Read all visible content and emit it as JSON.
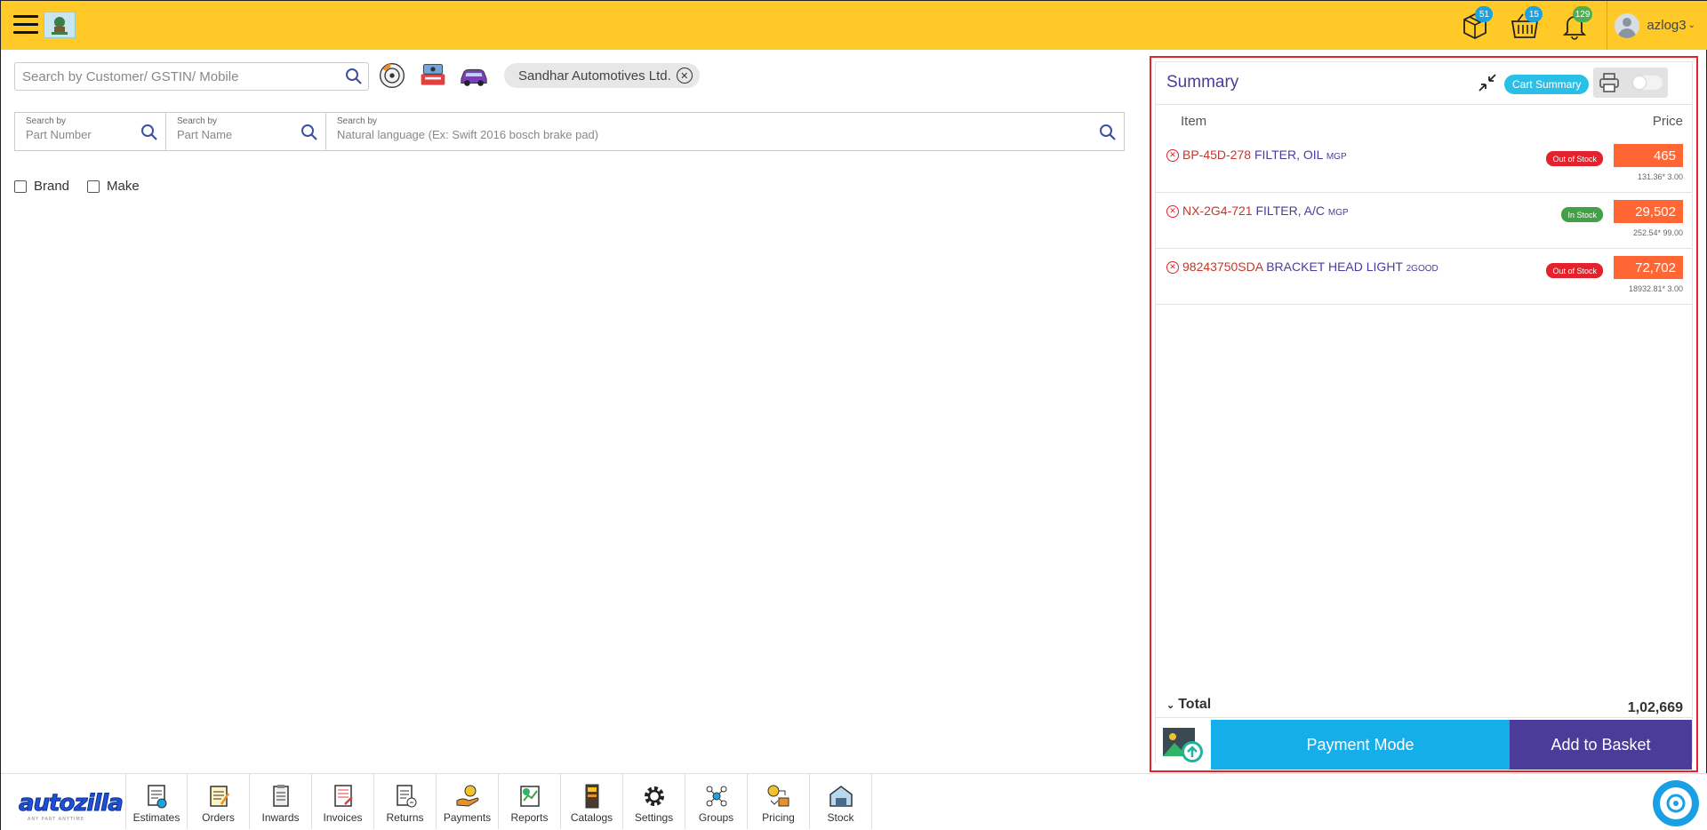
{
  "header": {
    "icons": [
      {
        "name": "packages-icon",
        "badge": "51",
        "badge_color": "#1aa3e0"
      },
      {
        "name": "basket-icon",
        "badge": "15",
        "badge_color": "#1aa3e0"
      },
      {
        "name": "bell-icon",
        "badge": "129",
        "badge_color": "#4caf50"
      }
    ],
    "user": "azlog3",
    "bar_color": "#ffc928"
  },
  "customer_search": {
    "placeholder": "Search by Customer/ GSTIN/ Mobile"
  },
  "selected_customer": "Sandhar Automotives Ltd.",
  "part_search": {
    "part_number": {
      "label": "Search by",
      "placeholder": "Part Number"
    },
    "part_name": {
      "label": "Search by",
      "placeholder": "Part Name"
    },
    "natural": {
      "label": "Search by",
      "placeholder": "Natural language (Ex: Swift 2016 bosch brake pad)"
    }
  },
  "filters": {
    "brand": "Brand",
    "make": "Make"
  },
  "summary": {
    "title": "Summary",
    "cart_summary_label": "Cart Summary",
    "col_item": "Item",
    "col_price": "Price",
    "items": [
      {
        "part_no": "BP-45D-278",
        "name": "FILTER, OIL",
        "brand": "MGP",
        "stock": "Out of Stock",
        "price": "465",
        "calc": "131.36* 3.00"
      },
      {
        "part_no": "NX-2G4-721",
        "name": "FILTER, A/C",
        "brand": "MGP",
        "stock": "In Stock",
        "price": "29,502",
        "calc": "252.54* 99.00"
      },
      {
        "part_no": "98243750SDA",
        "name": "BRACKET HEAD LIGHT",
        "brand": "2GOOD",
        "stock": "Out of Stock",
        "price": "72,702",
        "calc": "18932.81* 3.00"
      }
    ],
    "total_label": "Total",
    "total_value": "1,02,669",
    "payment_mode": "Payment Mode",
    "add_to_basket": "Add to Basket"
  },
  "bottom_nav": {
    "logo": "autozilla",
    "logo_sub": "ANY PART ANYTIME",
    "items": [
      {
        "label": "Estimates",
        "icon": "estimates-icon"
      },
      {
        "label": "Orders",
        "icon": "orders-icon"
      },
      {
        "label": "Inwards",
        "icon": "inwards-icon"
      },
      {
        "label": "Invoices",
        "icon": "invoices-icon"
      },
      {
        "label": "Returns",
        "icon": "returns-icon"
      },
      {
        "label": "Payments",
        "icon": "payments-icon"
      },
      {
        "label": "Reports",
        "icon": "reports-icon"
      },
      {
        "label": "Catalogs",
        "icon": "catalogs-icon"
      },
      {
        "label": "Settings",
        "icon": "settings-icon"
      },
      {
        "label": "Groups",
        "icon": "groups-icon"
      },
      {
        "label": "Pricing",
        "icon": "pricing-icon"
      },
      {
        "label": "Stock",
        "icon": "stock-icon"
      }
    ]
  },
  "colors": {
    "accent_purple": "#4c3c9a",
    "accent_blue": "#14aeea",
    "price_orange": "#ff6633",
    "out_of_stock": "#e2222c",
    "in_stock": "#43a047"
  }
}
